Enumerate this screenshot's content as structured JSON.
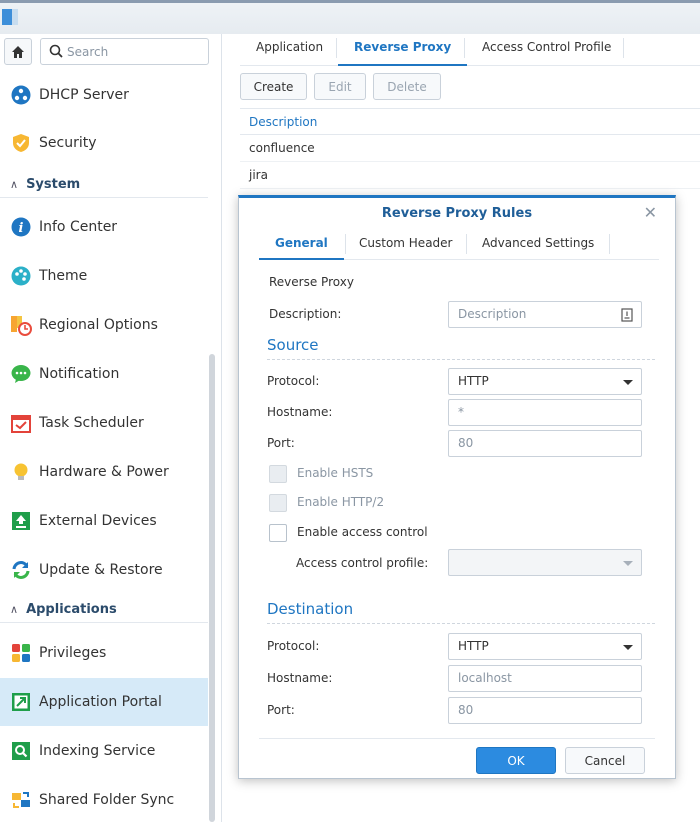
{
  "window": {
    "app_icon": "app-portal-icon"
  },
  "sidebar": {
    "search_placeholder": "Search",
    "items": [
      {
        "label": "DHCP Server",
        "icon": "dhcp-icon"
      },
      {
        "label": "Security",
        "icon": "shield-icon"
      },
      {
        "label": "Info Center",
        "icon": "info-icon"
      },
      {
        "label": "Theme",
        "icon": "palette-icon"
      },
      {
        "label": "Regional Options",
        "icon": "regional-icon"
      },
      {
        "label": "Notification",
        "icon": "chat-bubble-icon"
      },
      {
        "label": "Task Scheduler",
        "icon": "calendar-check-icon"
      },
      {
        "label": "Hardware & Power",
        "icon": "lightbulb-icon"
      },
      {
        "label": "External Devices",
        "icon": "upload-device-icon"
      },
      {
        "label": "Update & Restore",
        "icon": "refresh-icon"
      },
      {
        "label": "Privileges",
        "icon": "privileges-icon"
      },
      {
        "label": "Application Portal",
        "icon": "portal-icon",
        "active": true
      },
      {
        "label": "Indexing Service",
        "icon": "index-search-icon"
      },
      {
        "label": "Shared Folder Sync",
        "icon": "folder-sync-icon"
      }
    ],
    "sections": {
      "system": "System",
      "applications": "Applications"
    }
  },
  "main": {
    "tabs": [
      "Application",
      "Reverse Proxy",
      "Access Control Profile"
    ],
    "active_tab": "Reverse Proxy",
    "toolbar": {
      "create": "Create",
      "edit": "Edit",
      "delete": "Delete"
    },
    "grid": {
      "header": "Description",
      "rows": [
        "confluence",
        "jira"
      ]
    }
  },
  "dialog": {
    "title": "Reverse Proxy Rules",
    "tabs": [
      "General",
      "Custom Header",
      "Advanced Settings"
    ],
    "active_tab": "General",
    "subtitle": "Reverse Proxy",
    "description_label": "Description:",
    "description_placeholder": "Description",
    "source": {
      "title": "Source",
      "protocol_label": "Protocol:",
      "protocol_value": "HTTP",
      "hostname_label": "Hostname:",
      "hostname_placeholder": "*",
      "port_label": "Port:",
      "port_placeholder": "80",
      "enable_hsts": "Enable HSTS",
      "enable_http2": "Enable HTTP/2",
      "enable_access_control": "Enable access control",
      "access_profile_label": "Access control profile:"
    },
    "destination": {
      "title": "Destination",
      "protocol_label": "Protocol:",
      "protocol_value": "HTTP",
      "hostname_label": "Hostname:",
      "hostname_placeholder": "localhost",
      "port_label": "Port:",
      "port_placeholder": "80"
    },
    "ok": "OK",
    "cancel": "Cancel"
  },
  "colors": {
    "accent": "#1f76c2",
    "active_bg": "#d6eaf8",
    "ok_bg": "#2c8be0"
  }
}
